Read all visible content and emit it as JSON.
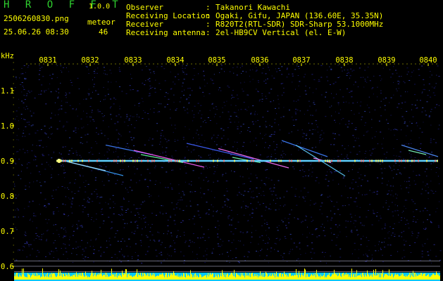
{
  "header": {
    "app_name": "H R O F F T",
    "version": "1.0.0",
    "filename": "2506260830.png",
    "timestamp": "25.06.26 08:30",
    "meteor_label": "meteor",
    "meteor_count": "46",
    "info": [
      {
        "label": "Observer",
        "sep": ":",
        "value": "Takanori Kawachi"
      },
      {
        "label": "Receiving Location",
        "sep": ":",
        "value": "Ogaki, Gifu, JAPAN (136.60E, 35.35N)"
      },
      {
        "label": "Receiver",
        "sep": ":",
        "value": "R820T2(RTL-SDR) SDR-Sharp 53.1000MHz"
      },
      {
        "label": "Receiving antenna",
        "sep": ":",
        "value": "2el-HB9CV Vertical (el. E-W)"
      }
    ]
  },
  "chart_data": {
    "type": "heatmap",
    "ylabel": "kHz",
    "ylim": [
      0.58,
      1.2
    ],
    "yticks": [
      "1.1",
      "1.0",
      "0.9",
      "0.8",
      "0.7",
      "0.6"
    ],
    "yticks_values": [
      1.1,
      1.0,
      0.9,
      0.8,
      0.7,
      0.6
    ],
    "xticks": [
      "0831",
      "0832",
      "0833",
      "0834",
      "0835",
      "0836",
      "0837",
      "0838",
      "0839",
      "0840"
    ],
    "carrier_khz": 0.9,
    "colors": {
      "background": "#000000",
      "noise": "#1a1a6e",
      "carrier": "#40c8ff",
      "echo": "#ff66ff",
      "axis": "#ffff00",
      "bottom_bars": "#ffff00",
      "bottom_fill": "#00c8ff"
    }
  }
}
